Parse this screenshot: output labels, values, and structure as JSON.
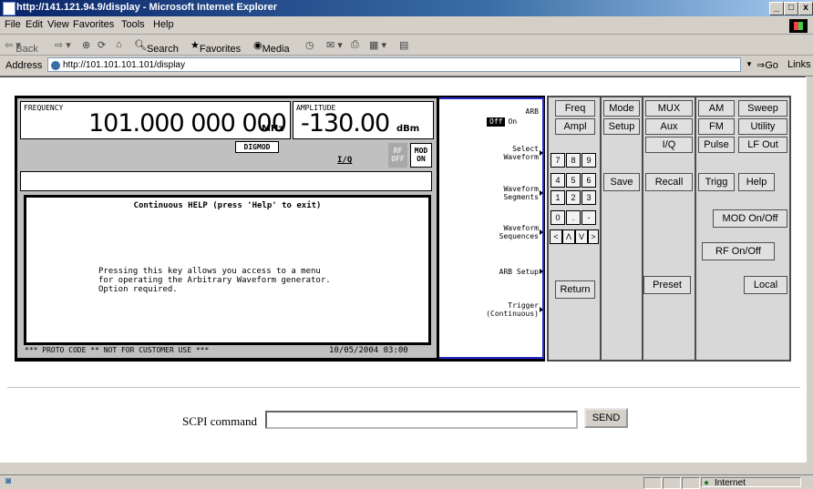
{
  "window": {
    "title": "http://141.121.94.9/display - Microsoft Internet Explorer",
    "buttons": [
      "_",
      "□",
      "x"
    ]
  },
  "menu": [
    "File",
    "Edit",
    "View",
    "Favorites",
    "Tools",
    "Help"
  ],
  "toolbar": {
    "back": "Back",
    "search": "Search",
    "favorites": "Favorites",
    "media": "Media"
  },
  "address": {
    "label": "Address",
    "url": "http://101.101.101.101/display",
    "go": "Go",
    "links": "Links"
  },
  "instrument": {
    "frequency_label": "FREQUENCY",
    "frequency_value": "101.000 000 000",
    "frequency_unit": "MHz",
    "amplitude_label": "AMPLITUDE",
    "amplitude_value": "-130.00",
    "amplitude_unit": "dBm",
    "digmod": "DIGMOD",
    "iq": "I/Q",
    "rf_off": "RF OFF",
    "mod_on": "MOD ON",
    "help_title": "Continuous HELP (press 'Help' to exit)",
    "help_body": "Pressing this key allows you access to a menu\nfor operating the Arbitrary Waveform generator.\nOption required.",
    "status_left": "*** PROTO CODE ** NOT FOR CUSTOMER USE ***",
    "status_right": "10/05/2004 03:00"
  },
  "softkeys": {
    "arb_label": "ARB",
    "arb_off": "Off",
    "arb_on": "On",
    "select_waveform": "Select\nWaveform",
    "waveform_segments": "Waveform\nSegments",
    "waveform_sequences": "Waveform\nSequences",
    "arb_setup": "ARB Setup",
    "trigger": "Trigger\n(Continuous)"
  },
  "front_panel": {
    "freq": "Freq",
    "ampl": "Ampl",
    "mode": "Mode",
    "setup": "Setup",
    "mux": "MUX",
    "aux": "Aux",
    "iq": "I/Q",
    "am": "AM",
    "fm": "FM",
    "pulse": "Pulse",
    "sweep": "Sweep",
    "utility": "Utility",
    "lf_out": "LF Out",
    "save": "Save",
    "recall": "Recall",
    "trigg": "Trigg",
    "help": "Help",
    "mod_onoff": "MOD On/Off",
    "rf_onoff": "RF On/Off",
    "return": "Return",
    "preset": "Preset",
    "local": "Local",
    "keypad": [
      "7",
      "8",
      "9",
      "4",
      "5",
      "6",
      "1",
      "2",
      "3",
      "0",
      ".",
      "-",
      "<",
      "Λ",
      "V",
      ">"
    ]
  },
  "form": {
    "scpi_label": "SCPI command",
    "scpi_value": "",
    "send": "SEND"
  },
  "statusbar": {
    "zone": "Internet"
  }
}
